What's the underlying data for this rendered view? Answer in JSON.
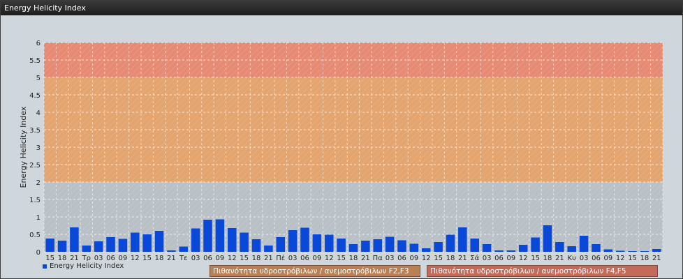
{
  "window": {
    "title": "Energy Helicity Index"
  },
  "legend": {
    "series_label": "Energy Helicity Index"
  },
  "risk_bands": {
    "f2_f3_label": "Πιθανότητα υδροστρόβιλων / ανεμοστρόβιλων F2,F3",
    "f4_f5_label": "Πιθανότητα υδροστρόβιλων / ανεμοστρόβιλων F4,F5"
  },
  "colors": {
    "bar": "#0a48d8",
    "band_low": "#b9c0c6",
    "band_mid": "#e3a46f",
    "band_high": "#e68a74",
    "grid": "#ffffff"
  },
  "chart_data": {
    "type": "bar",
    "title": "Energy Helicity Index",
    "ylabel": "Energy Helicity Index",
    "ylim": [
      0,
      6
    ],
    "yticks": [
      0,
      0.5,
      1,
      1.5,
      2,
      2.5,
      3,
      3.5,
      4,
      4.5,
      5,
      5.5,
      6
    ],
    "bands": [
      {
        "from": 0,
        "to": 2,
        "color": "#b9c0c6"
      },
      {
        "from": 2,
        "to": 5,
        "color": "#e3a46f"
      },
      {
        "from": 5,
        "to": 6,
        "color": "#e68a74"
      }
    ],
    "categories": [
      "15",
      "18",
      "21",
      "Τρ",
      "03",
      "06",
      "09",
      "12",
      "15",
      "18",
      "21",
      "Τε",
      "03",
      "06",
      "09",
      "12",
      "15",
      "18",
      "21",
      "Πέ",
      "03",
      "06",
      "09",
      "12",
      "15",
      "18",
      "21",
      "Πα",
      "03",
      "06",
      "09",
      "12",
      "15",
      "18",
      "21",
      "Σά",
      "03",
      "06",
      "09",
      "12",
      "15",
      "18",
      "21",
      "Κυ",
      "03",
      "06",
      "09",
      "12",
      "15",
      "18",
      "21"
    ],
    "series": [
      {
        "name": "Energy Helicity Index",
        "values": [
          0.38,
          0.32,
          0.7,
          0.18,
          0.3,
          0.42,
          0.37,
          0.55,
          0.5,
          0.6,
          0.04,
          0.15,
          0.67,
          0.92,
          0.93,
          0.68,
          0.55,
          0.36,
          0.18,
          0.42,
          0.62,
          0.69,
          0.5,
          0.49,
          0.38,
          0.22,
          0.32,
          0.36,
          0.43,
          0.33,
          0.23,
          0.1,
          0.28,
          0.49,
          0.7,
          0.38,
          0.22,
          0.04,
          0.04,
          0.2,
          0.41,
          0.76,
          0.28,
          0.16,
          0.46,
          0.22,
          0.07,
          0.03,
          0.02,
          0.02,
          0.08
        ]
      }
    ]
  }
}
